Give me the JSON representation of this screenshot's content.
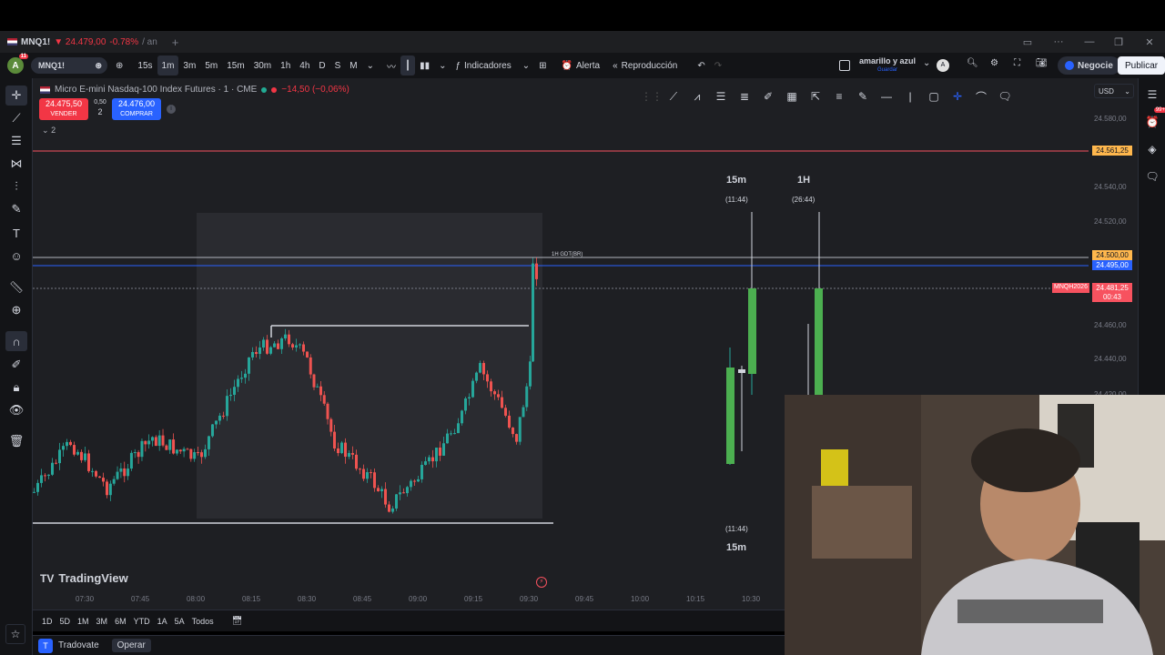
{
  "tab": {
    "symbol": "MNQ1!",
    "price": "▼ 24.479,00",
    "change": "-0.78%",
    "suffix": "/ an"
  },
  "toolbar": {
    "avatar_letter": "A",
    "avatar_badge": "11",
    "symbol": "MNQ1!",
    "intervals": [
      "15s",
      "1m",
      "3m",
      "5m",
      "15m",
      "30m",
      "1h",
      "4h",
      "D",
      "S",
      "M"
    ],
    "active_interval": "1m",
    "indicators": "Indicadores",
    "alert": "Alerta",
    "replay": "Reproducción",
    "layout_name": "amarillo y azul",
    "layout_sub": "Guardar",
    "trade": "Negocie",
    "publish": "Publicar"
  },
  "chart": {
    "title": "Micro E-mini Nasdaq-100 Index Futures · 1 · CME",
    "change": "−14,50 (−0,06%)",
    "sell_price": "24.475,50",
    "sell_label": "VENDER",
    "buy_price": "24.476,00",
    "buy_label": "COMPRAR",
    "spread_top": "0,50",
    "spread_qty": "2",
    "collapse": "2",
    "currency": "USD",
    "price_ticks": [
      "24.580,00",
      "24.540,00",
      "24.520,00",
      "24.460,00",
      "24.440,00",
      "24.420,00"
    ],
    "label_orange": "24.561,25",
    "label_level": "24.500,00",
    "label_blue": "24.495,00",
    "label_current": "24.481,25",
    "label_countdown": "00:43",
    "mnq_label": "MNQH2026",
    "annotation": "1H GDT(BR)",
    "tf_15m_top": "15m",
    "tf_15m_top_sub": "(11:44)",
    "tf_1h_top": "1H",
    "tf_1h_top_sub": "(26:44)",
    "tf_15m_bottom_sub": "(11:44)",
    "tf_15m_bottom": "15m",
    "time_ticks": [
      "07:30",
      "07:45",
      "08:00",
      "08:15",
      "08:30",
      "08:45",
      "09:00",
      "09:15",
      "09:30",
      "09:45",
      "10:00",
      "10:15",
      "10:30"
    ],
    "brand": "TradingView"
  },
  "ranges": [
    "1D",
    "5D",
    "1M",
    "3M",
    "6M",
    "YTD",
    "1A",
    "5A",
    "Todos"
  ],
  "broker": {
    "name": "Tradovate",
    "action": "Operar"
  },
  "colors": {
    "up": "#26a69a",
    "up_bright": "#4caf50",
    "down": "#ef5350",
    "level_blue": "#2962ff",
    "level_orange": "#f7525f"
  }
}
